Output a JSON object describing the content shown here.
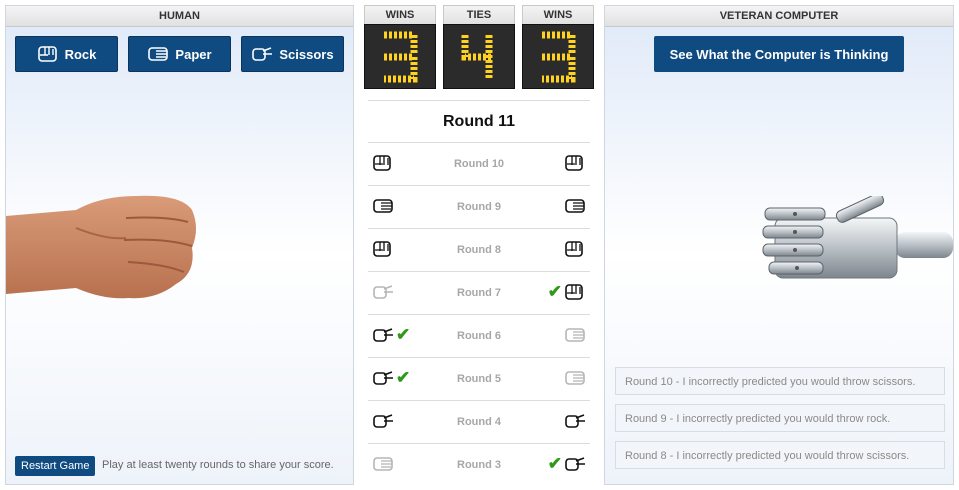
{
  "human": {
    "title": "HUMAN",
    "buttons": [
      {
        "label": "Rock",
        "icon": "rock-icon"
      },
      {
        "label": "Paper",
        "icon": "paper-icon"
      },
      {
        "label": "Scissors",
        "icon": "scissors-icon"
      }
    ],
    "current_throw": "rock",
    "restart_label": "Restart Game",
    "note": "Play at least twenty rounds to share your score."
  },
  "score": {
    "boxes": [
      {
        "label": "WINS",
        "value": "3"
      },
      {
        "label": "TIES",
        "value": "4"
      },
      {
        "label": "WINS",
        "value": "3"
      }
    ],
    "led_color": "#ffd21f"
  },
  "round": {
    "title": "Round 11"
  },
  "history": [
    {
      "label": "Round 10",
      "human": "rock",
      "computer": "rock",
      "winner": "tie"
    },
    {
      "label": "Round 9",
      "human": "paper",
      "computer": "paper",
      "winner": "tie"
    },
    {
      "label": "Round 8",
      "human": "rock",
      "computer": "rock",
      "winner": "tie"
    },
    {
      "label": "Round 7",
      "human": "scissors",
      "computer": "rock",
      "winner": "computer"
    },
    {
      "label": "Round 6",
      "human": "scissors",
      "computer": "paper",
      "winner": "human"
    },
    {
      "label": "Round 5",
      "human": "scissors",
      "computer": "paper",
      "winner": "human"
    },
    {
      "label": "Round 4",
      "human": "scissors",
      "computer": "scissors",
      "winner": "tie"
    },
    {
      "label": "Round 3",
      "human": "paper",
      "computer": "scissors",
      "winner": "computer"
    }
  ],
  "computer": {
    "title": "VETERAN COMPUTER",
    "think_label": "See What the Computer is Thinking",
    "current_throw": "paper",
    "messages": [
      "Round 10 - I incorrectly predicted you would throw scissors.",
      "Round 9 - I incorrectly predicted you would throw rock.",
      "Round 8 - I incorrectly predicted you would throw scissors."
    ]
  },
  "colors": {
    "button": "#0f4a80",
    "check": "#2f9a1a"
  }
}
